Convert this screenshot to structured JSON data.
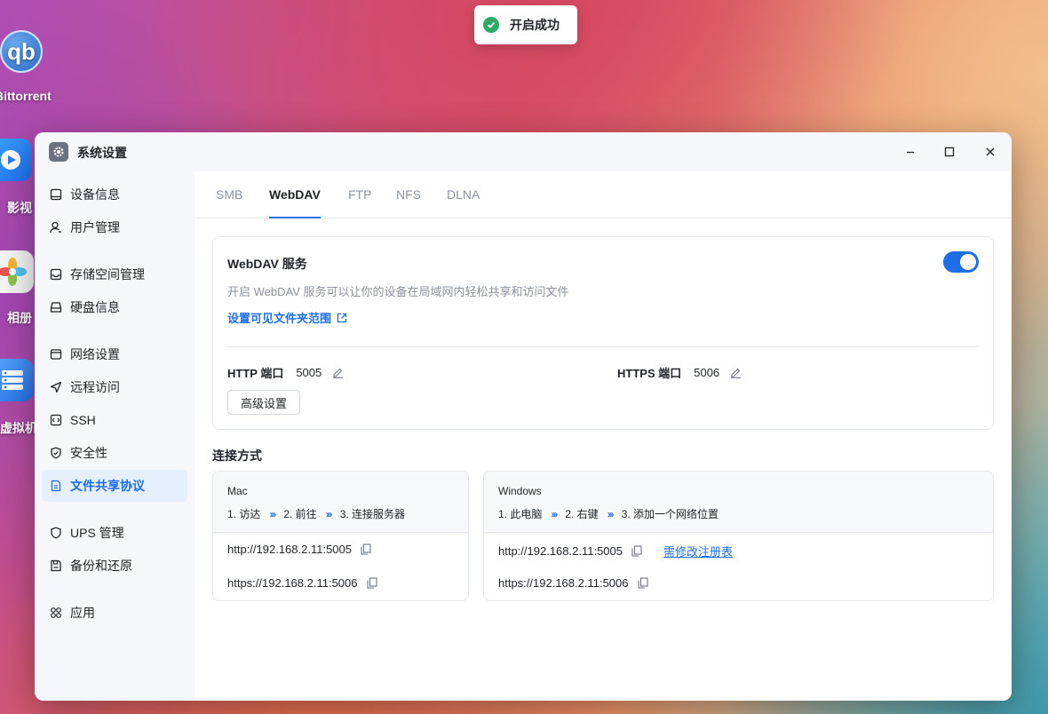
{
  "desktop": {
    "icons": [
      {
        "label": "Bittorrent",
        "glyph": "qb"
      },
      {
        "label": "影视"
      },
      {
        "label": "相册"
      },
      {
        "label": "虚拟机"
      }
    ]
  },
  "toast": {
    "message": "开启成功",
    "icon": "check-circle-icon",
    "color": "#2fa96a"
  },
  "window": {
    "title": "系统设置",
    "controls": {
      "minimize": "minimize-icon",
      "maximize": "maximize-icon",
      "close": "close-icon"
    }
  },
  "sidebar": {
    "items": [
      {
        "label": "设备信息",
        "icon": "device-icon"
      },
      {
        "label": "用户管理",
        "icon": "user-icon"
      },
      {
        "label": "存储空间管理",
        "icon": "storage-icon"
      },
      {
        "label": "硬盘信息",
        "icon": "disk-icon"
      },
      {
        "label": "网络设置",
        "icon": "network-icon"
      },
      {
        "label": "远程访问",
        "icon": "remote-icon"
      },
      {
        "label": "SSH",
        "icon": "code-icon"
      },
      {
        "label": "安全性",
        "icon": "shield-icon"
      },
      {
        "label": "文件共享协议",
        "icon": "file-share-icon",
        "active": true
      },
      {
        "label": "UPS 管理",
        "icon": "ups-shield-icon"
      },
      {
        "label": "备份和还原",
        "icon": "backup-icon"
      },
      {
        "label": "应用",
        "icon": "apps-icon"
      }
    ]
  },
  "tabs": [
    {
      "label": "SMB"
    },
    {
      "label": "WebDAV",
      "active": true
    },
    {
      "label": "FTP"
    },
    {
      "label": "NFS"
    },
    {
      "label": "DLNA"
    }
  ],
  "service": {
    "title": "WebDAV 服务",
    "enabled": true,
    "description": "开启 WebDAV 服务可以让你的设备在局域网内轻松共享和访问文件",
    "folder_link": "设置可见文件夹范围",
    "http_label": "HTTP 端口",
    "http_port": "5005",
    "https_label": "HTTPS 端口",
    "https_port": "5006",
    "advanced_button": "高级设置"
  },
  "connection": {
    "title": "连接方式",
    "mac": {
      "os": "Mac",
      "steps": [
        "1. 访达",
        "2. 前往",
        "3. 连接服务器"
      ],
      "urls": [
        "http://192.168.2.11:5005",
        "https://192.168.2.11:5006"
      ]
    },
    "windows": {
      "os": "Windows",
      "steps": [
        "1. 此电脑",
        "2. 右键",
        "3. 添加一个网络位置"
      ],
      "urls": [
        "http://192.168.2.11:5005",
        "https://192.168.2.11:5006"
      ],
      "registry_link": "需修改注册表"
    }
  },
  "colors": {
    "accent": "#1d6ee8",
    "active_bg": "#e6effd",
    "success": "#2fa96a"
  }
}
